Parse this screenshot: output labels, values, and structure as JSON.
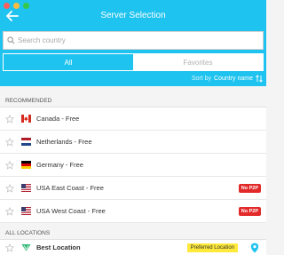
{
  "window": {
    "title": "Server Selection"
  },
  "search": {
    "placeholder": "Search country"
  },
  "tabs": [
    {
      "label": "All"
    },
    {
      "label": "Favorites"
    }
  ],
  "sort": {
    "label": "Sort by",
    "value": "Country name"
  },
  "sections": {
    "recommended": "RECOMMENDED",
    "all_locations": "ALL LOCATIONS"
  },
  "servers": [
    {
      "name": "Canada - Free",
      "flag": "flag-canada-icon"
    },
    {
      "name": "Netherlands - Free",
      "flag": "flag-netherlands-icon"
    },
    {
      "name": "Germany - Free",
      "flag": "flag-germany-icon"
    },
    {
      "name": "USA East Coast - Free",
      "flag": "flag-usa-icon",
      "badge": "No P2P"
    },
    {
      "name": "USA West Coast - Free",
      "flag": "flag-usa-icon",
      "badge": "No P2P"
    }
  ],
  "best": {
    "name": "Best Location",
    "badge": "Preferred Location"
  },
  "colors": {
    "accent": "#1fc3ef",
    "badge_red": "#e22a2a",
    "preferred": "#ffe93b"
  }
}
